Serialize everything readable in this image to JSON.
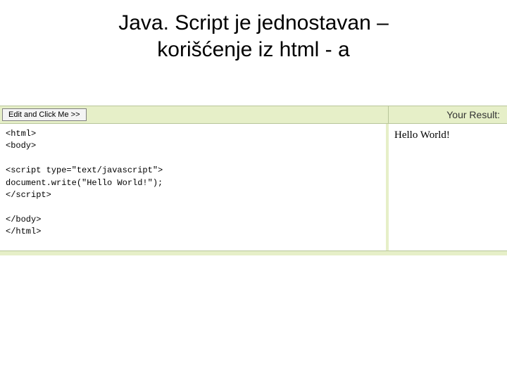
{
  "title": {
    "line1": "Java. Script je jednostavan –",
    "line2": "korišćenje iz html - a"
  },
  "toolbar": {
    "run_label": "Edit and Click Me >>",
    "result_label": "Your Result:"
  },
  "code": {
    "l1": "<html>",
    "l2": "<body>",
    "l3": "",
    "l4": "<script type=\"text/javascript\">",
    "l5": "document.write(\"Hello World!\");",
    "l6": "</script>",
    "l7": "",
    "l8": "</body>",
    "l9": "</html>"
  },
  "result": {
    "output": "Hello World!"
  }
}
